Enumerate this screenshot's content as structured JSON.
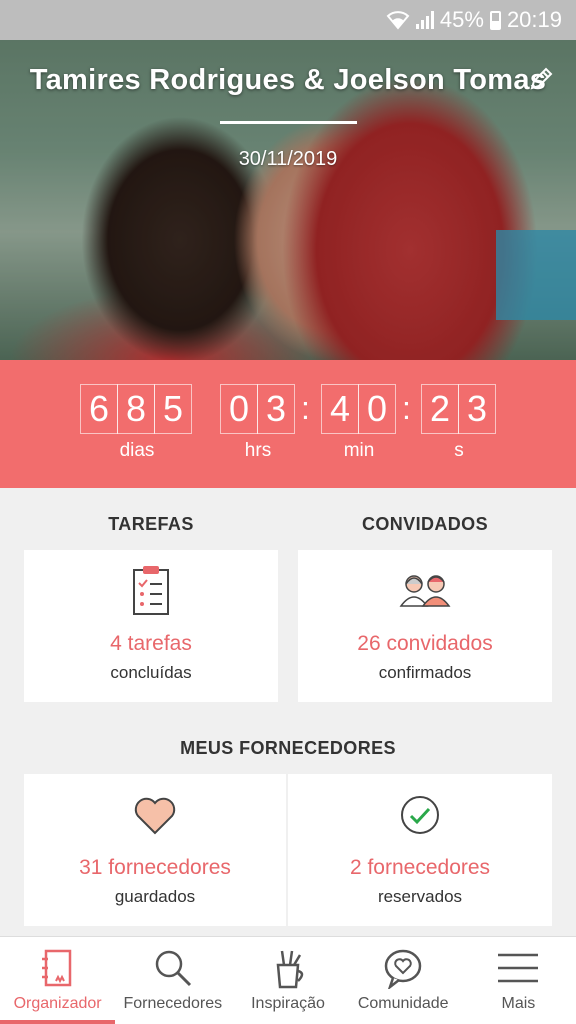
{
  "status": {
    "battery": "45%",
    "time": "20:19"
  },
  "header": {
    "couple_names": "Tamires Rodrigues & Joelson Tomas",
    "date": "30/11/2019"
  },
  "countdown": {
    "days": [
      "6",
      "8",
      "5"
    ],
    "hours": [
      "0",
      "3"
    ],
    "minutes": [
      "4",
      "0"
    ],
    "seconds": [
      "2",
      "3"
    ],
    "labels": {
      "days": "dias",
      "hours": "hrs",
      "minutes": "min",
      "seconds": "s"
    }
  },
  "tasks": {
    "title": "TAREFAS",
    "count": "4 tarefas",
    "status": "concluídas"
  },
  "guests": {
    "title": "CONVIDADOS",
    "count": "26 convidados",
    "status": "confirmados"
  },
  "vendors": {
    "title": "MEUS FORNECEDORES",
    "saved": {
      "count": "31 fornecedores",
      "status": "guardados"
    },
    "booked": {
      "count": "2 fornecedores",
      "status": "reservados"
    }
  },
  "nav": {
    "items": [
      {
        "label": "Organizador",
        "icon": "notebook-icon",
        "active": true
      },
      {
        "label": "Fornecedores",
        "icon": "search-icon",
        "active": false
      },
      {
        "label": "Inspiração",
        "icon": "brushes-cup-icon",
        "active": false
      },
      {
        "label": "Comunidade",
        "icon": "chat-heart-icon",
        "active": false
      },
      {
        "label": "Mais",
        "icon": "menu-icon",
        "active": false
      }
    ]
  },
  "colors": {
    "accent": "#f26d6d",
    "accent_text": "#e8676b"
  }
}
